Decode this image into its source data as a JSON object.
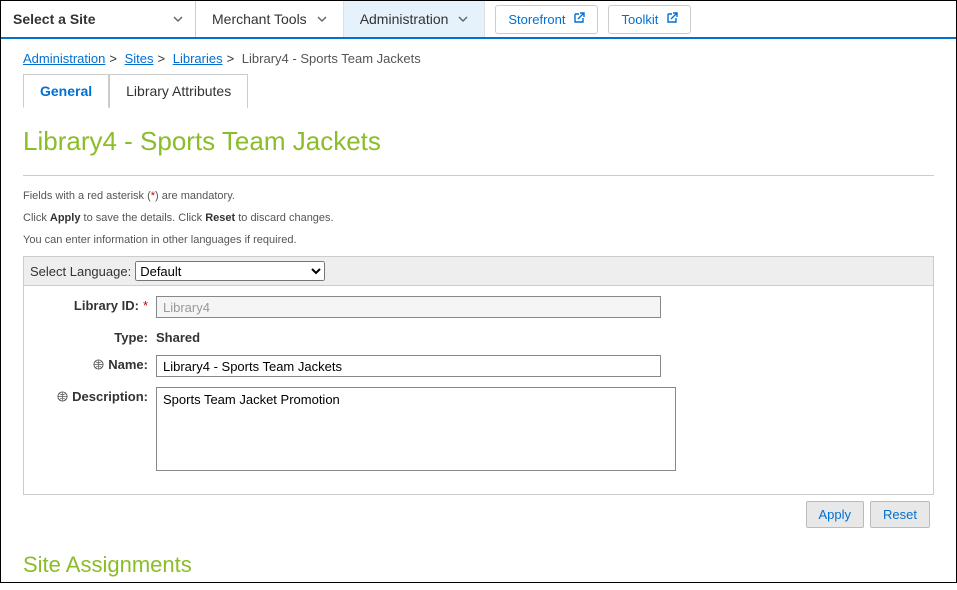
{
  "topbar": {
    "site_selector_label": "Select a Site",
    "nav": [
      {
        "label": "Merchant Tools",
        "active": false
      },
      {
        "label": "Administration",
        "active": true
      }
    ],
    "storefront_label": "Storefront",
    "toolkit_label": "Toolkit"
  },
  "breadcrumb": {
    "items": [
      {
        "label": "Administration",
        "link": true
      },
      {
        "label": "Sites",
        "link": true
      },
      {
        "label": "Libraries",
        "link": true
      },
      {
        "label": "Library4 - Sports Team Jackets",
        "link": false
      }
    ]
  },
  "tabs": {
    "general": "General",
    "attributes": "Library Attributes"
  },
  "page_title": "Library4 - Sports Team Jackets",
  "helptext": {
    "line1_pre": "Fields with a red asterisk (",
    "line1_ast": "*",
    "line1_post": ") are mandatory.",
    "line2_a": "Click ",
    "line2_apply": "Apply",
    "line2_b": " to save the details. Click ",
    "line2_reset": "Reset",
    "line2_c": " to discard changes.",
    "line3": "You can enter information in other languages if required."
  },
  "lang": {
    "label": "Select Language:",
    "selected": "Default"
  },
  "form": {
    "library_id_label": "Library ID:",
    "library_id_value": "Library4",
    "type_label": "Type:",
    "type_value": "Shared",
    "name_label": "Name:",
    "name_value": "Library4 - Sports Team Jackets",
    "description_label": "Description:",
    "description_value": "Sports Team Jacket Promotion"
  },
  "buttons": {
    "apply": "Apply",
    "reset": "Reset"
  },
  "section_site_assignments": "Site Assignments"
}
